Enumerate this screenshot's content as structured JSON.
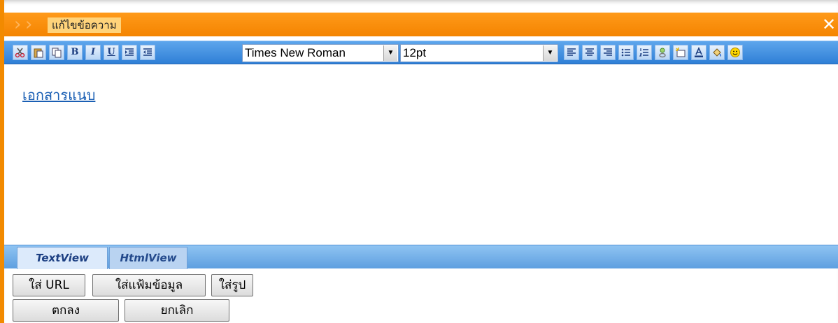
{
  "window": {
    "title": "แก้ไขข้อความ",
    "close_symbol": "✕"
  },
  "toolbar": {
    "buttons_left": [
      {
        "name": "cut-icon",
        "glyph": "✂"
      },
      {
        "name": "paste-icon",
        "glyph": "📋"
      },
      {
        "name": "copy-icon",
        "glyph": "⎘"
      },
      {
        "name": "bold-icon",
        "glyph": "B"
      },
      {
        "name": "italic-icon",
        "glyph": "I"
      },
      {
        "name": "underline-icon",
        "glyph": "U"
      },
      {
        "name": "indent-icon",
        "glyph": "⇥"
      },
      {
        "name": "outdent-icon",
        "glyph": "⇤"
      }
    ],
    "font_family": "Times New Roman",
    "font_size": "12pt",
    "buttons_right": [
      "align-left-icon",
      "align-center-icon",
      "align-right-icon",
      "bullet-list-icon",
      "numbered-list-icon",
      "link-icon",
      "insert-image-icon",
      "font-color-icon",
      "highlight-icon",
      "emoticon-icon"
    ]
  },
  "editor": {
    "link_text": "เอกสารแนบ"
  },
  "tabs": {
    "text_view": "TextView",
    "html_view": "HtmlView"
  },
  "actions": {
    "insert_url": "ใส่ URL",
    "insert_file": "ใส่แฟ้มข้อมูล",
    "insert_image": "ใส่รูป",
    "ok": "ตกลง",
    "cancel": "ยกเลิก"
  },
  "colors": {
    "title_bar": "#f48400",
    "toolbar": "#2f7fd6",
    "link": "#1a5fb4"
  }
}
